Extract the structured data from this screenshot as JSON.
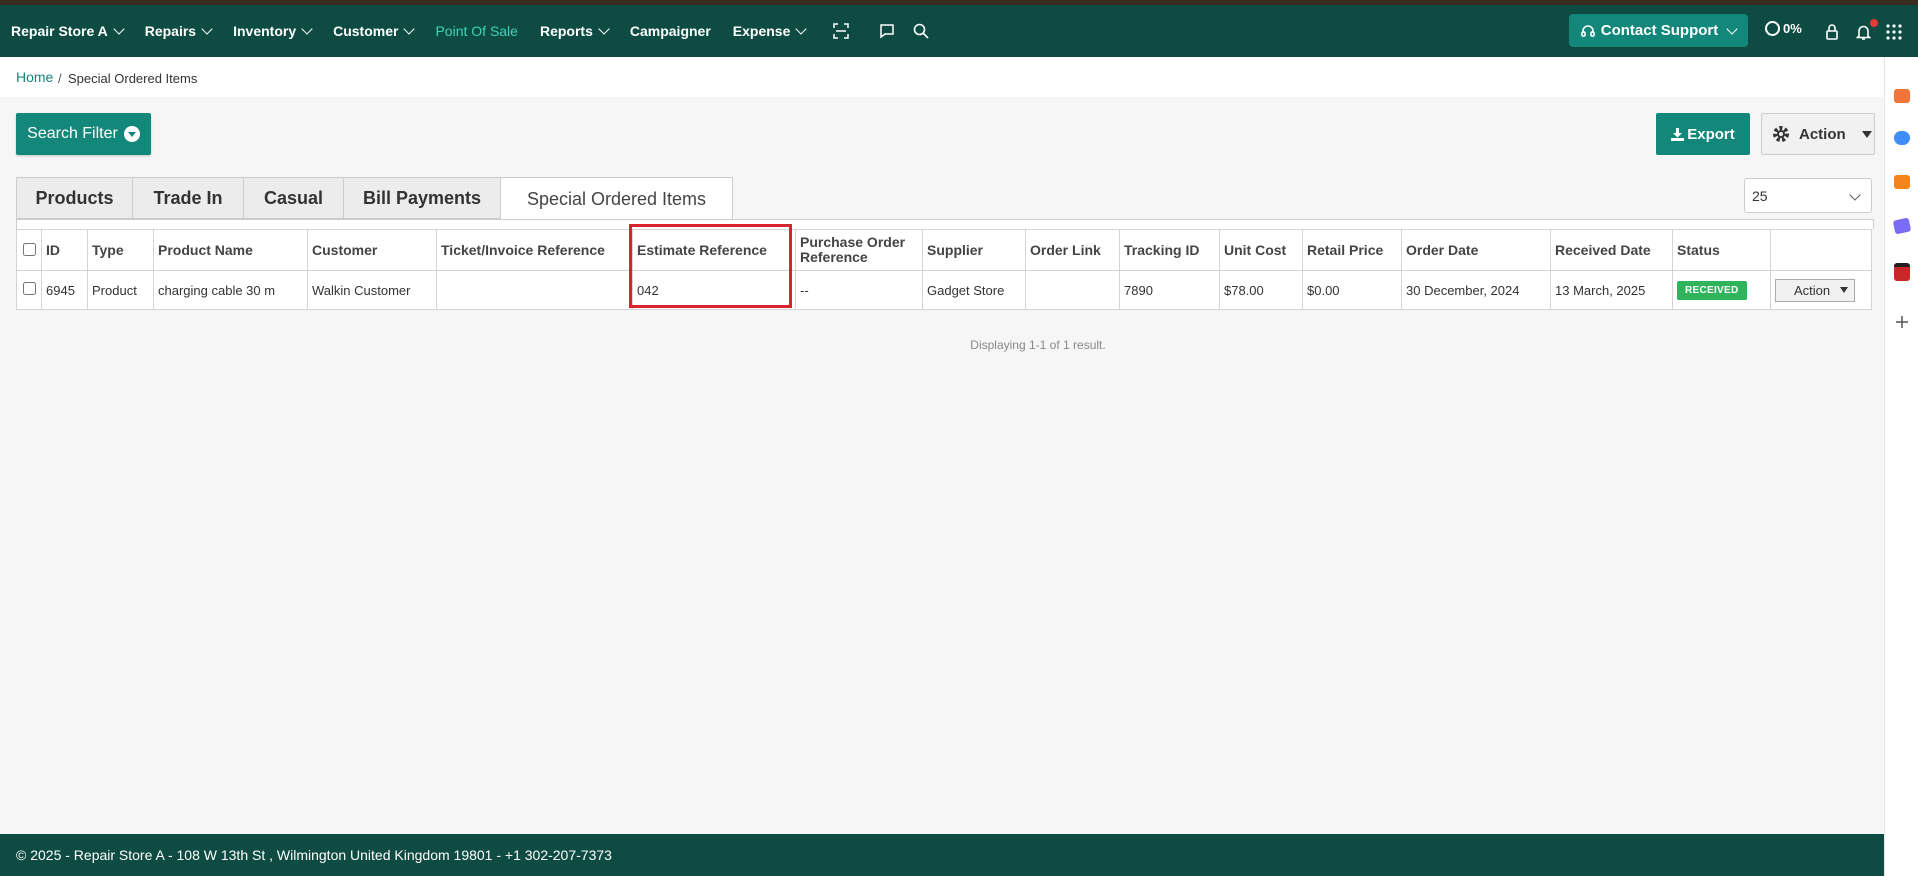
{
  "nav": {
    "store": "Repair Store A",
    "items": [
      "Repairs",
      "Inventory",
      "Customer",
      "Point Of Sale",
      "Reports",
      "Campaigner",
      "Expense"
    ],
    "contact_support": "Contact Support",
    "progress": "0%"
  },
  "breadcrumb": {
    "home": "Home",
    "separator": "/",
    "current": "Special Ordered Items"
  },
  "toolbar": {
    "search_filter": "Search Filter",
    "export": "Export",
    "action": "Action"
  },
  "tabs": [
    "Products",
    "Trade In",
    "Casual",
    "Bill Payments",
    "Special Ordered Items"
  ],
  "per_page": "25",
  "table": {
    "headers": [
      "ID",
      "Type",
      "Product Name",
      "Customer",
      "Ticket/Invoice Reference",
      "Estimate Reference",
      "Purchase Order Reference",
      "Supplier",
      "Order Link",
      "Tracking ID",
      "Unit Cost",
      "Retail Price",
      "Order Date",
      "Received Date",
      "Status"
    ],
    "po_header_line1": "Purchase Order",
    "po_header_line2": "Reference",
    "row": {
      "id": "6945",
      "type": "Product",
      "product_name": "charging cable 30 m",
      "customer": "Walkin Customer",
      "ticket_ref": "",
      "estimate_ref": "042",
      "po_ref": "--",
      "supplier": "Gadget Store",
      "order_link": "",
      "tracking_id": "7890",
      "unit_cost": "$78.00",
      "retail_price": "$0.00",
      "order_date": "30 December, 2024",
      "received_date": "13 March, 2025",
      "status": "RECEIVED",
      "action": "Action"
    }
  },
  "result_text": "Displaying 1-1 of 1 result.",
  "footer": "© 2025 - Repair Store A - 108 W 13th St , Wilmington United Kingdom 19801 - +1 302-207-7373",
  "colors": {
    "nav_bg": "#0e4b42",
    "accent": "#13887a",
    "active_nav": "#3fd3b8",
    "status_green": "#2fb45c",
    "highlight": "#d9232d"
  }
}
